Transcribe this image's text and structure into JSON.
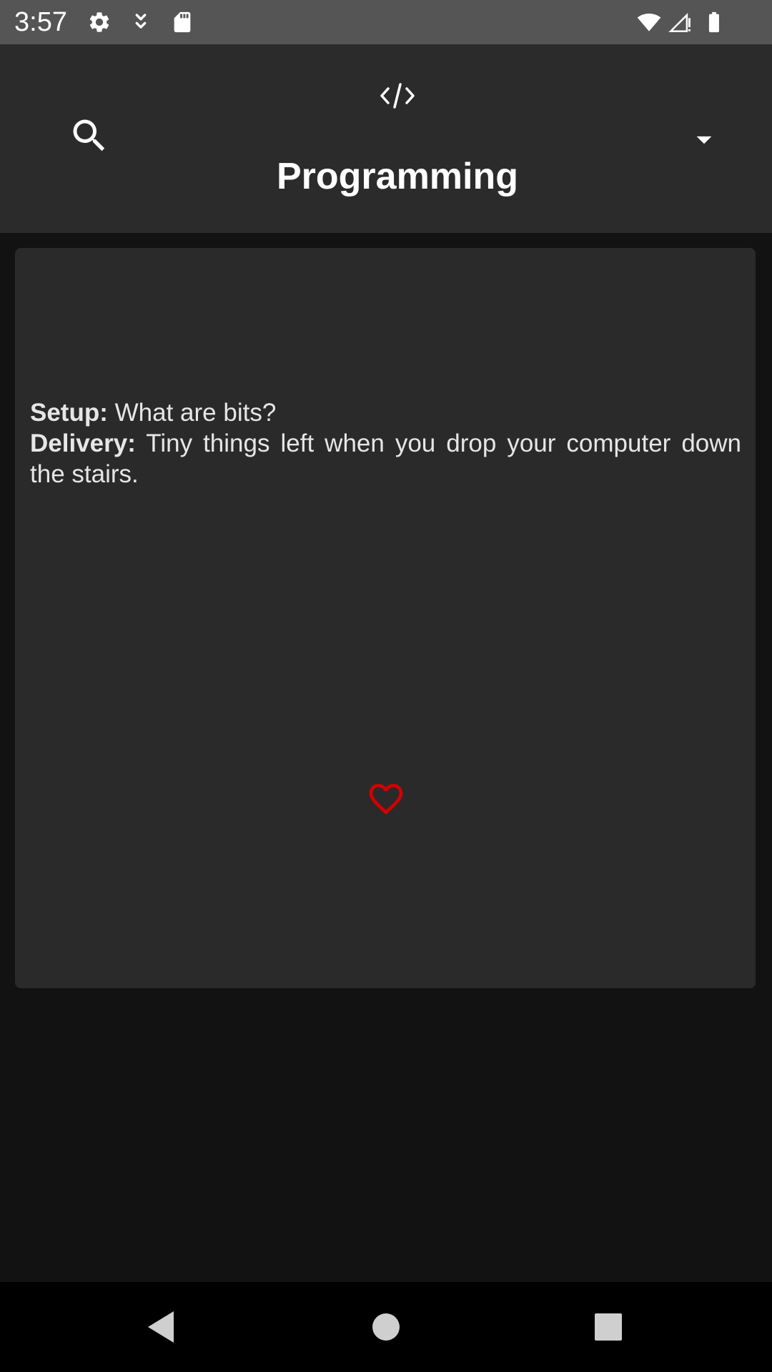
{
  "status_bar": {
    "time": "3:57",
    "left_icons": [
      "gear-icon",
      "download-icon",
      "sd-card-icon"
    ],
    "right_icons": [
      "wifi-icon",
      "cell-signal-icon",
      "battery-icon"
    ]
  },
  "app_bar": {
    "category_icon": "code-icon",
    "category_title": "Programming",
    "search_icon": "search-icon",
    "dropdown_icon": "dropdown-arrow-icon"
  },
  "joke": {
    "setup_label": "Setup:",
    "setup_text": "What are bits?",
    "delivery_label": "Delivery:",
    "delivery_text": "Tiny things left when you drop your computer down the stairs."
  },
  "favorite": {
    "icon": "heart-outline-icon",
    "color": "#d50000"
  },
  "nav_bar": {
    "back_icon": "back-triangle-icon",
    "home_icon": "home-circle-icon",
    "recents_icon": "recents-square-icon"
  },
  "colors": {
    "status_bar": "#555555",
    "app_bar": "#2b2b2b",
    "background": "#121212",
    "card": "#2a2a2a"
  }
}
